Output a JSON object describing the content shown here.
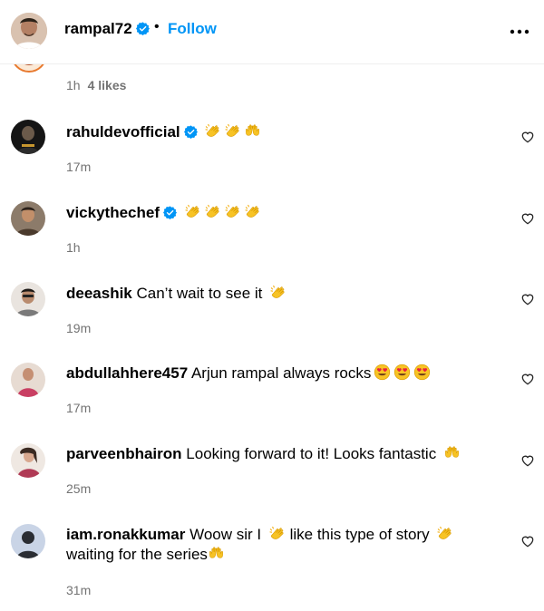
{
  "header": {
    "username": "rampal72",
    "dot": "•",
    "follow_label": "Follow"
  },
  "top_meta": {
    "time": "1h",
    "likes": "4 likes"
  },
  "comments": [
    {
      "username": "rahuldevofficial",
      "verified": true,
      "text": "",
      "emojis": [
        "clap",
        "clap",
        "raised-hands"
      ],
      "time": "17m"
    },
    {
      "username": "vickythechef",
      "verified": true,
      "text": "",
      "emojis": [
        "clap",
        "clap",
        "clap",
        "clap"
      ],
      "time": "1h"
    },
    {
      "username": "deeashik",
      "verified": false,
      "text": "Can’t wait to see it",
      "emojis": [
        "clap"
      ],
      "time": "19m"
    },
    {
      "username": "abdullahhere457",
      "verified": false,
      "text": "Arjun rampal always rocks",
      "emojis": [
        "heart-eyes",
        "heart-eyes",
        "heart-eyes"
      ],
      "time": "17m"
    },
    {
      "username": "parveenbhairon",
      "verified": false,
      "text": "Looking forward to it! Looks fantastic",
      "emojis": [
        "raised-hands"
      ],
      "time": "25m"
    },
    {
      "username": "iam.ronakkumar",
      "verified": false,
      "text_part1": "Woow sir I",
      "text_part2": "like this type of story",
      "text_part3": "waiting for the series",
      "emojis": [
        "clap",
        "clap",
        "raised-hands"
      ],
      "time": "31m"
    }
  ],
  "colors": {
    "follow": "#0095f6",
    "verified": "#0095f6",
    "meta": "#737373"
  }
}
